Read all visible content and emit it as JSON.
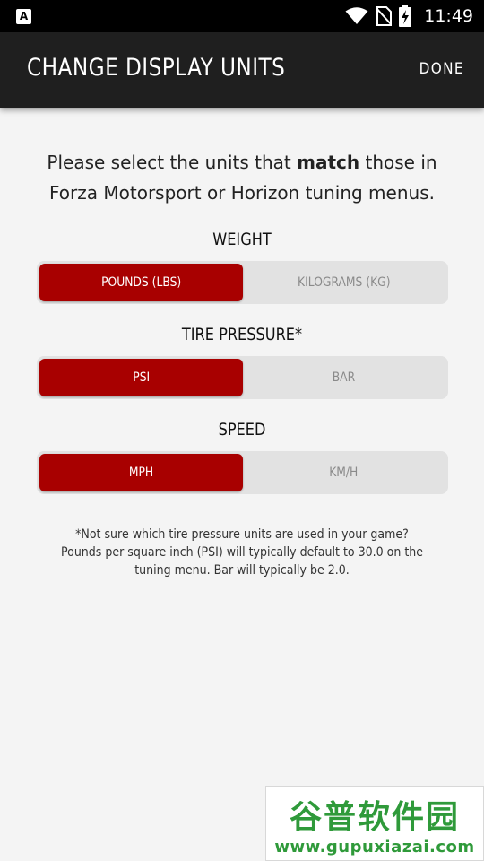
{
  "status_bar": {
    "left_icon": "A",
    "time": "11:49",
    "icons": [
      "wifi-icon",
      "no-sim-icon",
      "battery-charging-icon"
    ]
  },
  "app_bar": {
    "title": "CHANGE DISPLAY UNITS",
    "done_label": "DONE"
  },
  "intro": {
    "before": "Please select the units that ",
    "bold": "match",
    "after": " those in Forza Motorsport or Horizon tuning menus."
  },
  "sections": [
    {
      "label": "WEIGHT",
      "options": [
        "POUNDS (LBS)",
        "KILOGRAMS (KG)"
      ],
      "selected": "POUNDS (LBS)"
    },
    {
      "label": "TIRE PRESSURE*",
      "options": [
        "PSI",
        "BAR"
      ],
      "selected": "PSI"
    },
    {
      "label": "SPEED",
      "options": [
        "MPH",
        "KM/H"
      ],
      "selected": "MPH"
    }
  ],
  "footnote": "*Not sure which tire pressure units are used in your game? Pounds per square inch (PSI) will typically default to 30.0 on the tuning menu. Bar will typically be 2.0.",
  "colors": {
    "accent": "#a80000",
    "appbar": "#1f1f1f",
    "background": "#f4f4f4",
    "segment_bg": "#e2e2e2"
  },
  "watermark": {
    "title": "谷普软件园",
    "url": "www.gupuxiazai.com"
  }
}
